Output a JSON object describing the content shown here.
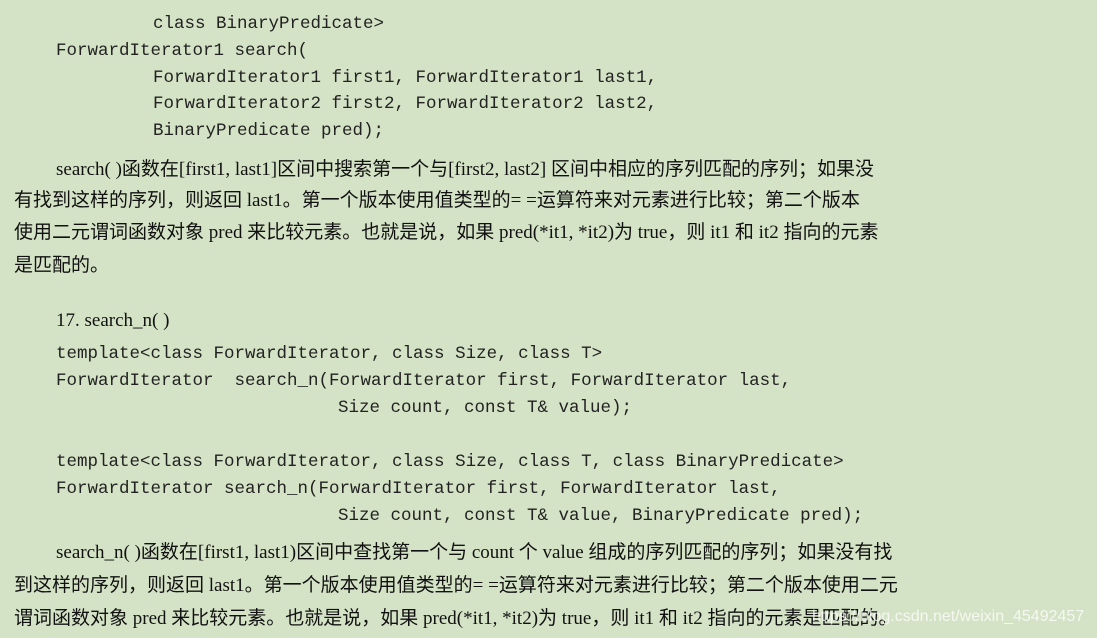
{
  "block1": {
    "lines": [
      "class BinaryPredicate>",
      "ForwardIterator1 search(",
      "ForwardIterator1 first1, ForwardIterator1 last1,",
      "ForwardIterator2 first2, ForwardIterator2 last2,",
      "BinaryPredicate pred);"
    ]
  },
  "para1": {
    "lines": [
      "search( )函数在[first1, last1]区间中搜索第一个与[first2, last2] 区间中相应的序列匹配的序列；如果没",
      "有找到这样的序列，则返回 last1。第一个版本使用值类型的= =运算符来对元素进行比较；第二个版本",
      "使用二元谓词函数对象 pred 来比较元素。也就是说，如果 pred(*it1, *it2)为 true，则 it1 和 it2 指向的元素",
      "是匹配的。"
    ]
  },
  "section": {
    "heading": "17.  search_n( )"
  },
  "block2": {
    "lines": [
      "template<class ForwardIterator, class Size, class T>",
      "ForwardIterator  search_n(ForwardIterator first, ForwardIterator last,",
      "Size count, const T& value);"
    ]
  },
  "block3": {
    "lines": [
      "template<class ForwardIterator, class Size, class T, class BinaryPredicate>",
      "ForwardIterator search_n(ForwardIterator first, ForwardIterator last,",
      "Size count, const T& value, BinaryPredicate pred);"
    ]
  },
  "para2": {
    "lines": [
      "search_n( )函数在[first1, last1)区间中查找第一个与 count 个 value 组成的序列匹配的序列；如果没有找",
      "到这样的序列，则返回 last1。第一个版本使用值类型的= =运算符来对元素进行比较；第二个版本使用二元",
      "谓词函数对象 pred 来比较元素。也就是说，如果 pred(*it1, *it2)为 true，则 it1 和 it2 指向的元素是匹配的。"
    ]
  },
  "watermark": "https://blog.csdn.net/weixin_45492457"
}
